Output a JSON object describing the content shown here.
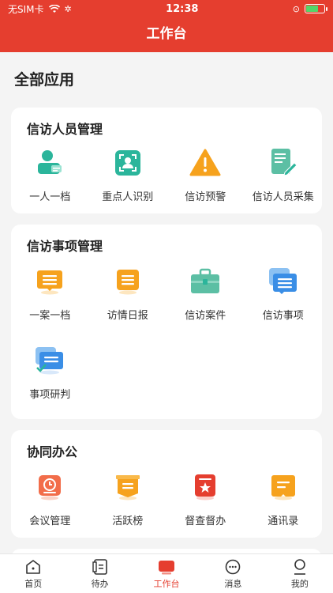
{
  "status_bar": {
    "carrier": "无SIM卡",
    "time": "12:38",
    "battery_percent": 70
  },
  "header": {
    "title": "工作台"
  },
  "section": {
    "title": "全部应用"
  },
  "cards": [
    {
      "title": "信访人员管理",
      "items": [
        {
          "label": "一人一档",
          "icon": "person-card-icon"
        },
        {
          "label": "重点人识别",
          "icon": "face-scan-icon"
        },
        {
          "label": "信访预警",
          "icon": "warning-icon"
        },
        {
          "label": "信访人员采集",
          "icon": "form-edit-icon"
        }
      ]
    },
    {
      "title": "信访事项管理",
      "items": [
        {
          "label": "一案一档",
          "icon": "chat-list-icon"
        },
        {
          "label": "访情日报",
          "icon": "daily-report-icon"
        },
        {
          "label": "信访案件",
          "icon": "briefcase-icon"
        },
        {
          "label": "信访事项",
          "icon": "message-stack-icon"
        },
        {
          "label": "事项研判",
          "icon": "analysis-icon"
        }
      ]
    },
    {
      "title": "协同办公",
      "items": [
        {
          "label": "会议管理",
          "icon": "meeting-icon"
        },
        {
          "label": "活跃榜",
          "icon": "ranking-icon"
        },
        {
          "label": "督查督办",
          "icon": "supervision-icon"
        },
        {
          "label": "通讯录",
          "icon": "contacts-icon"
        }
      ]
    }
  ],
  "tabbar": [
    {
      "label": "首页",
      "icon": "home-icon"
    },
    {
      "label": "待办",
      "icon": "todo-icon"
    },
    {
      "label": "工作台",
      "icon": "workbench-icon",
      "active": true
    },
    {
      "label": "消息",
      "icon": "message-icon"
    },
    {
      "label": "我的",
      "icon": "profile-icon"
    }
  ],
  "colors": {
    "brand_red": "#e53e2f",
    "teal": "#2bb59b",
    "orange": "#f6a21d",
    "blue": "#3a8ee6"
  }
}
